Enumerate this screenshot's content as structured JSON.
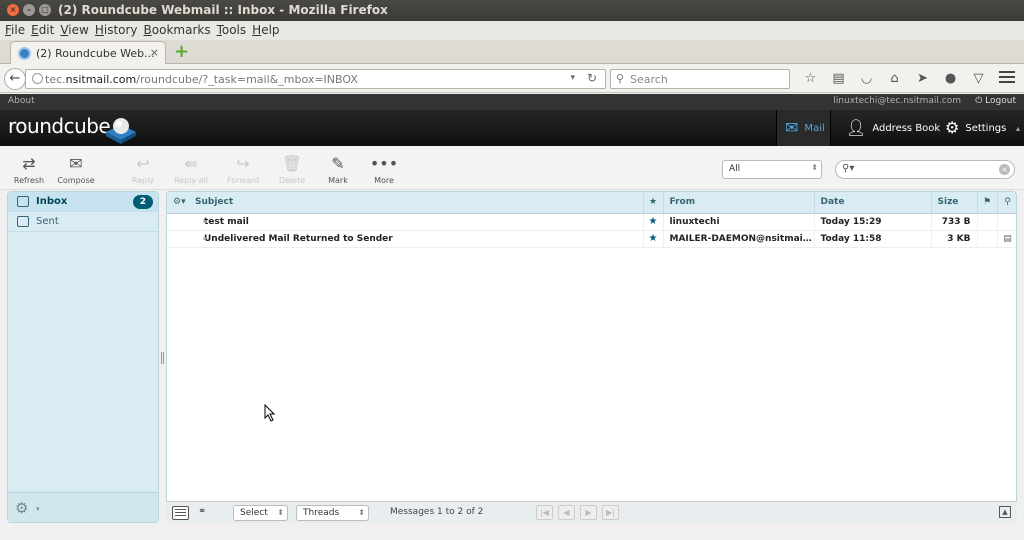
{
  "window": {
    "title": "(2) Roundcube Webmail :: Inbox - Mozilla Firefox"
  },
  "menubar": [
    "File",
    "Edit",
    "View",
    "History",
    "Bookmarks",
    "Tools",
    "Help"
  ],
  "tab": {
    "title": "(2) Roundcube Web...",
    "close": "×",
    "new": "+"
  },
  "navbar": {
    "url_prefix": "tec.",
    "url_domain": "nsitmail.com",
    "url_path": "/roundcube/?_task=mail&_mbox=INBOX",
    "search_placeholder": "Search"
  },
  "rc_top": {
    "about": "About",
    "user": "linuxtechi@tec.nsitmail.com",
    "logout": "Logout"
  },
  "header": {
    "logo": "roundcube",
    "tasks": {
      "mail": "Mail",
      "addressbook": "Address Book",
      "settings": "Settings"
    }
  },
  "toolbar": {
    "refresh": "Refresh",
    "compose": "Compose",
    "reply": "Reply",
    "reply_all": "Reply all",
    "forward": "Forward",
    "delete": "Delete",
    "mark": "Mark",
    "more": "More"
  },
  "filter": {
    "selected": "All"
  },
  "folders": [
    {
      "name": "Inbox",
      "unread": "2"
    },
    {
      "name": "Sent"
    }
  ],
  "messagelist": {
    "columns": {
      "subject": "Subject",
      "from": "From",
      "date": "Date",
      "size": "Size"
    },
    "rows": [
      {
        "subject": "test mail",
        "from": "linuxtechi",
        "date": "Today 15:29",
        "size": "733 B",
        "attachment": ""
      },
      {
        "subject": "Undelivered Mail Returned to Sender",
        "from": "MAILER-DAEMON@nsitmail....",
        "date": "Today 11:58",
        "size": "3 KB",
        "attachment": "doc"
      }
    ]
  },
  "listfooter": {
    "select": "Select",
    "threads": "Threads",
    "count": "Messages 1 to 2 of 2"
  },
  "colors": {
    "accent": "#005d76",
    "folder_bg": "#d9ecf4",
    "header_bg": "#1a1a1a",
    "mail_active": "#4fa8dc"
  }
}
